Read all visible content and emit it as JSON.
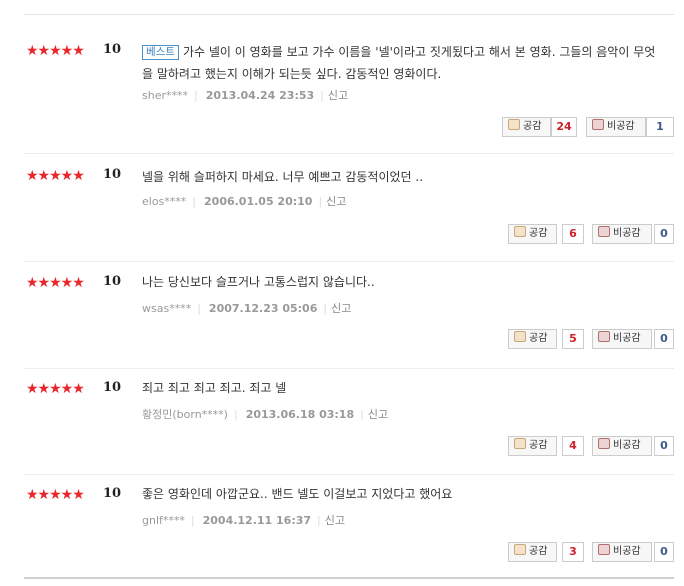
{
  "reviews": [
    {
      "stars": "★★★★★",
      "score": "10",
      "best": "베스트",
      "text": "가수 넬이 이 영화를 보고 가수 이름을 '넬'이라고 짓게됬다고 해서 본 영화. 그들의 음악이 무엇을 말하려고 했는지 이해가 되는듯 싶다. 감동적인 영화이다.",
      "user": "sher****",
      "date": "2013.04.24 23:53",
      "report": "신고",
      "like_label": "공감",
      "like_count": "24",
      "dislike_label": "비공감",
      "dislike_count": "1"
    },
    {
      "stars": "★★★★★",
      "score": "10",
      "best": "",
      "text": "넬을 위해 슬퍼하지 마세요. 너무 예쁘고 감동적이었던 ..",
      "user": "elos****",
      "date": "2006.01.05 20:10",
      "report": "신고",
      "like_label": "공감",
      "like_count": "6",
      "dislike_label": "비공감",
      "dislike_count": "0"
    },
    {
      "stars": "★★★★★",
      "score": "10",
      "best": "",
      "text": "나는 당신보다 슬프거나 고통스럽지 않습니다..",
      "user": "wsas****",
      "date": "2007.12.23 05:06",
      "report": "신고",
      "like_label": "공감",
      "like_count": "5",
      "dislike_label": "비공감",
      "dislike_count": "0"
    },
    {
      "stars": "★★★★★",
      "score": "10",
      "best": "",
      "text": "죄고 죄고 죄고 죄고. 죄고 넬",
      "user": "황정민(born****)",
      "date": "2013.06.18 03:18",
      "report": "신고",
      "like_label": "공감",
      "like_count": "4",
      "dislike_label": "비공감",
      "dislike_count": "0"
    },
    {
      "stars": "★★★★★",
      "score": "10",
      "best": "",
      "text": "좋은 영화인데 아깝군요.. 밴드 넬도 이걸보고 지었다고 했어요",
      "user": "gnlf****",
      "date": "2004.12.11 16:37",
      "report": "신고",
      "like_label": "공감",
      "like_count": "3",
      "dislike_label": "비공감",
      "dislike_count": "0"
    }
  ]
}
